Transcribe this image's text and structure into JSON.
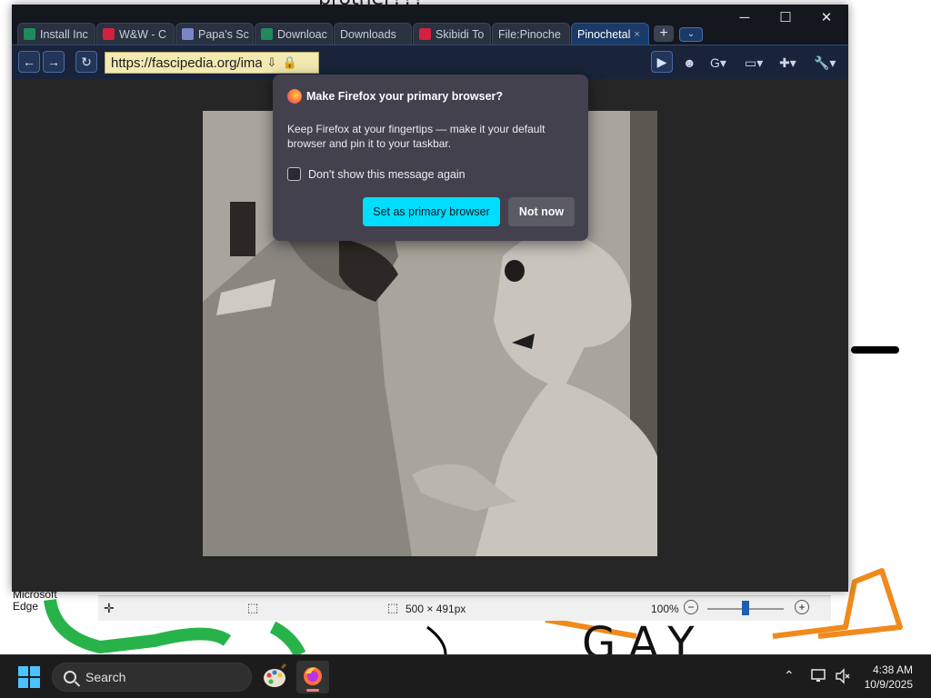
{
  "window": {
    "controls": {
      "minimize": "─",
      "maximize": "☐",
      "close": "✕"
    },
    "tabs": [
      {
        "label": "Install Inc",
        "favicon_color": "#1f8a5b",
        "active": false
      },
      {
        "label": "W&W - C",
        "favicon_color": "#d4213d",
        "active": false
      },
      {
        "label": "Papa's Sc",
        "favicon_color": "#7b86c9",
        "active": false
      },
      {
        "label": "Downloac",
        "favicon_color": "#1f8a5b",
        "active": false
      },
      {
        "label": "Downloads",
        "favicon_color": "",
        "active": false
      },
      {
        "label": "Skibidi To",
        "favicon_color": "#d4213d",
        "active": false
      },
      {
        "label": "File:Pinoche",
        "favicon_color": "",
        "active": false
      },
      {
        "label": "Pinochetal",
        "favicon_color": "",
        "active": true,
        "close": "×"
      }
    ],
    "new_tab": "+",
    "tab_list": "⌄"
  },
  "navbar": {
    "back": "←",
    "forward": "→",
    "reload": "↻",
    "url": "https://fascipedia.org/ima",
    "download_icon": "⇩",
    "lock_icon": "🔒",
    "go": "▶",
    "tools": [
      "☻",
      "G▾",
      "▭▾",
      "✚▾",
      "🔧▾"
    ]
  },
  "popup": {
    "title": "Make Firefox your primary browser?",
    "body": "Keep Firefox at your fingertips — make it your default browser and pin it to your taskbar.",
    "checkbox_label": "Don't show this message again",
    "checkbox_checked": false,
    "primary_button": "Set as primary browser",
    "secondary_button": "Not now"
  },
  "paint_status": {
    "dimensions": "500 × 491px",
    "zoom": "100%",
    "zoom_minus": "−",
    "zoom_plus": "+"
  },
  "desktop": {
    "edge_label_line1": "Microsoft",
    "edge_label_line2": "Edge",
    "scribble_text_top": "brother???",
    "scribble_text_bottom": "GAY"
  },
  "taskbar": {
    "search_placeholder": "Search",
    "time": "4:38 AM",
    "date": "10/9/2025",
    "tray_chevron": "⌃"
  },
  "colors": {
    "accent_button": "#00ddff",
    "popup_bg": "#42414d",
    "active_tab": "#1a3a68",
    "url_bar": "#f3eab2"
  }
}
